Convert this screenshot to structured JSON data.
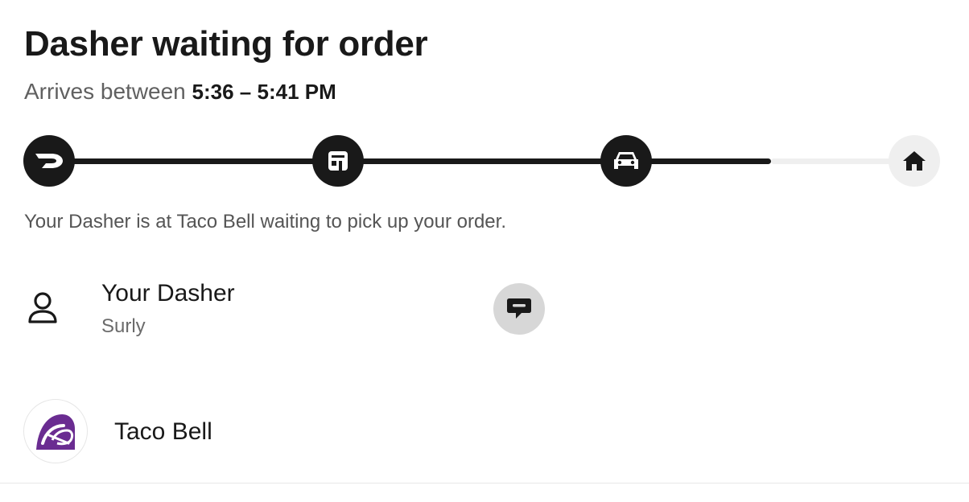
{
  "header": {
    "title": "Dasher waiting for order",
    "eta_prefix": "Arrives between ",
    "eta_time": "5:36 – 5:41 PM"
  },
  "tracker": {
    "steps": [
      {
        "icon": "doordash-logo-icon",
        "state": "complete"
      },
      {
        "icon": "store-icon",
        "state": "complete"
      },
      {
        "icon": "car-icon",
        "state": "complete"
      },
      {
        "icon": "home-icon",
        "state": "pending"
      }
    ],
    "progress_percent": 81
  },
  "status_message": "Your Dasher is at Taco Bell waiting to pick up your order.",
  "dasher": {
    "label": "Your Dasher",
    "name": "Surly",
    "icon": "person-icon",
    "action_icon": "chat-icon"
  },
  "store": {
    "name": "Taco Bell",
    "logo_icon": "taco-bell-logo-icon",
    "logo_color": "#6a2c91"
  },
  "colors": {
    "primary": "#191919",
    "secondary_text": "#606060",
    "track_inactive": "#efefef",
    "chat_button_bg": "#d7d7d7"
  }
}
